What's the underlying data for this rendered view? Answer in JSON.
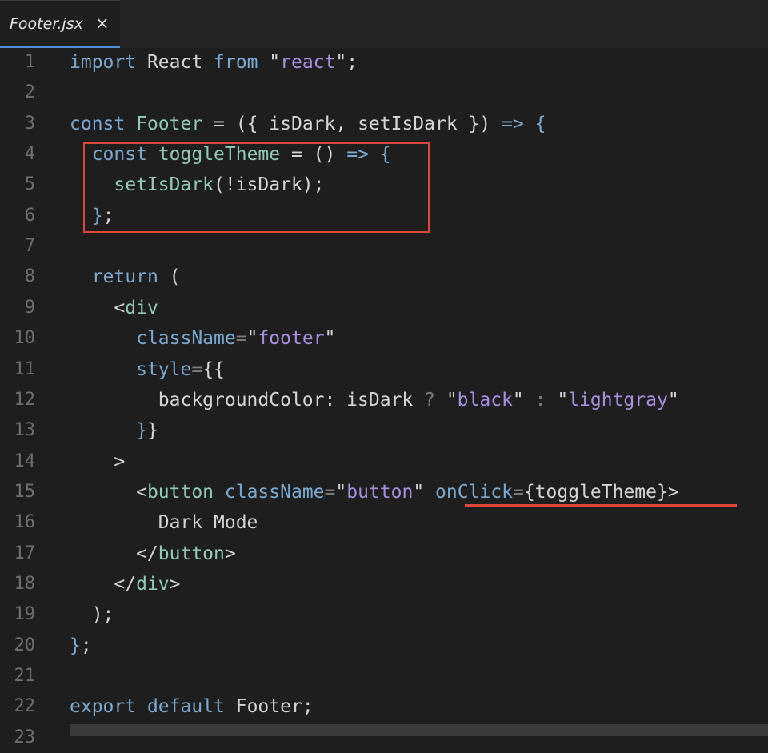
{
  "tab": {
    "label": "Footer.jsx",
    "close": "×"
  },
  "accent": {
    "tab_underline": "#4d8fd6",
    "highlight": "#e0463a"
  },
  "lines": [
    {
      "n": "1",
      "t": [
        [
          "kw",
          "import"
        ],
        [
          "ident",
          " React "
        ],
        [
          "kw",
          "from"
        ],
        [
          "ident",
          " \""
        ],
        [
          "str",
          "react"
        ],
        [
          "ident",
          "\";"
        ]
      ]
    },
    {
      "n": "2",
      "t": []
    },
    {
      "n": "3",
      "t": [
        [
          "kw",
          "const"
        ],
        [
          "ident",
          " "
        ],
        [
          "fn",
          "Footer"
        ],
        [
          "ident",
          " = ({ isDark, setIsDark }) "
        ],
        [
          "op",
          "=>"
        ],
        [
          "ident",
          " "
        ],
        [
          "op",
          "{"
        ]
      ]
    },
    {
      "n": "4",
      "t": [
        [
          "ident",
          "  "
        ],
        [
          "kw",
          "const"
        ],
        [
          "ident",
          " "
        ],
        [
          "fn",
          "toggleTheme"
        ],
        [
          "ident",
          " = () "
        ],
        [
          "op",
          "=>"
        ],
        [
          "ident",
          " "
        ],
        [
          "op",
          "{"
        ]
      ]
    },
    {
      "n": "5",
      "t": [
        [
          "ident",
          "    "
        ],
        [
          "fn",
          "setIsDark"
        ],
        [
          "ident",
          "(!isDark);"
        ]
      ]
    },
    {
      "n": "6",
      "t": [
        [
          "ident",
          "  "
        ],
        [
          "op",
          "}"
        ],
        [
          "ident",
          ";"
        ]
      ]
    },
    {
      "n": "7",
      "t": []
    },
    {
      "n": "8",
      "t": [
        [
          "ident",
          "  "
        ],
        [
          "kw",
          "return"
        ],
        [
          "ident",
          " ("
        ]
      ]
    },
    {
      "n": "9",
      "t": [
        [
          "ident",
          "    <"
        ],
        [
          "tag",
          "div"
        ]
      ]
    },
    {
      "n": "10",
      "t": [
        [
          "ident",
          "      "
        ],
        [
          "attr",
          "className"
        ],
        [
          "dim",
          "="
        ],
        [
          "ident",
          "\""
        ],
        [
          "str",
          "footer"
        ],
        [
          "ident",
          "\""
        ]
      ]
    },
    {
      "n": "11",
      "t": [
        [
          "ident",
          "      "
        ],
        [
          "attr",
          "style"
        ],
        [
          "dim",
          "="
        ],
        [
          "ident",
          "{{"
        ]
      ]
    },
    {
      "n": "12",
      "t": [
        [
          "ident",
          "        backgroundColor: isDark "
        ],
        [
          "dim",
          "?"
        ],
        [
          "ident",
          " \""
        ],
        [
          "str",
          "black"
        ],
        [
          "ident",
          "\" "
        ],
        [
          "dim",
          ":"
        ],
        [
          "ident",
          " \""
        ],
        [
          "str",
          "lightgray"
        ],
        [
          "ident",
          "\""
        ]
      ]
    },
    {
      "n": "13",
      "t": [
        [
          "ident",
          "      "
        ],
        [
          "op",
          "}"
        ],
        [
          "ident",
          "}"
        ]
      ]
    },
    {
      "n": "14",
      "t": [
        [
          "ident",
          "    >"
        ]
      ]
    },
    {
      "n": "15",
      "t": [
        [
          "ident",
          "      <"
        ],
        [
          "tag",
          "button"
        ],
        [
          "ident",
          " "
        ],
        [
          "attr",
          "className"
        ],
        [
          "dim",
          "="
        ],
        [
          "ident",
          "\""
        ],
        [
          "str",
          "button"
        ],
        [
          "ident",
          "\" "
        ],
        [
          "attr",
          "onClick"
        ],
        [
          "dim",
          "="
        ],
        [
          "ident",
          "{toggleTheme}>"
        ]
      ]
    },
    {
      "n": "16",
      "t": [
        [
          "ident",
          "        Dark Mode"
        ]
      ]
    },
    {
      "n": "17",
      "t": [
        [
          "ident",
          "      </"
        ],
        [
          "tag",
          "button"
        ],
        [
          "ident",
          ">"
        ]
      ]
    },
    {
      "n": "18",
      "t": [
        [
          "ident",
          "    </"
        ],
        [
          "tag",
          "div"
        ],
        [
          "ident",
          ">"
        ]
      ]
    },
    {
      "n": "19",
      "t": [
        [
          "ident",
          "  );"
        ]
      ]
    },
    {
      "n": "20",
      "t": [
        [
          "op",
          "}"
        ],
        [
          "ident",
          ";"
        ]
      ]
    },
    {
      "n": "21",
      "t": []
    },
    {
      "n": "22",
      "t": [
        [
          "kw",
          "export"
        ],
        [
          "ident",
          " "
        ],
        [
          "kw",
          "default"
        ],
        [
          "ident",
          " Footer;"
        ]
      ]
    },
    {
      "n": "23",
      "t": []
    }
  ]
}
